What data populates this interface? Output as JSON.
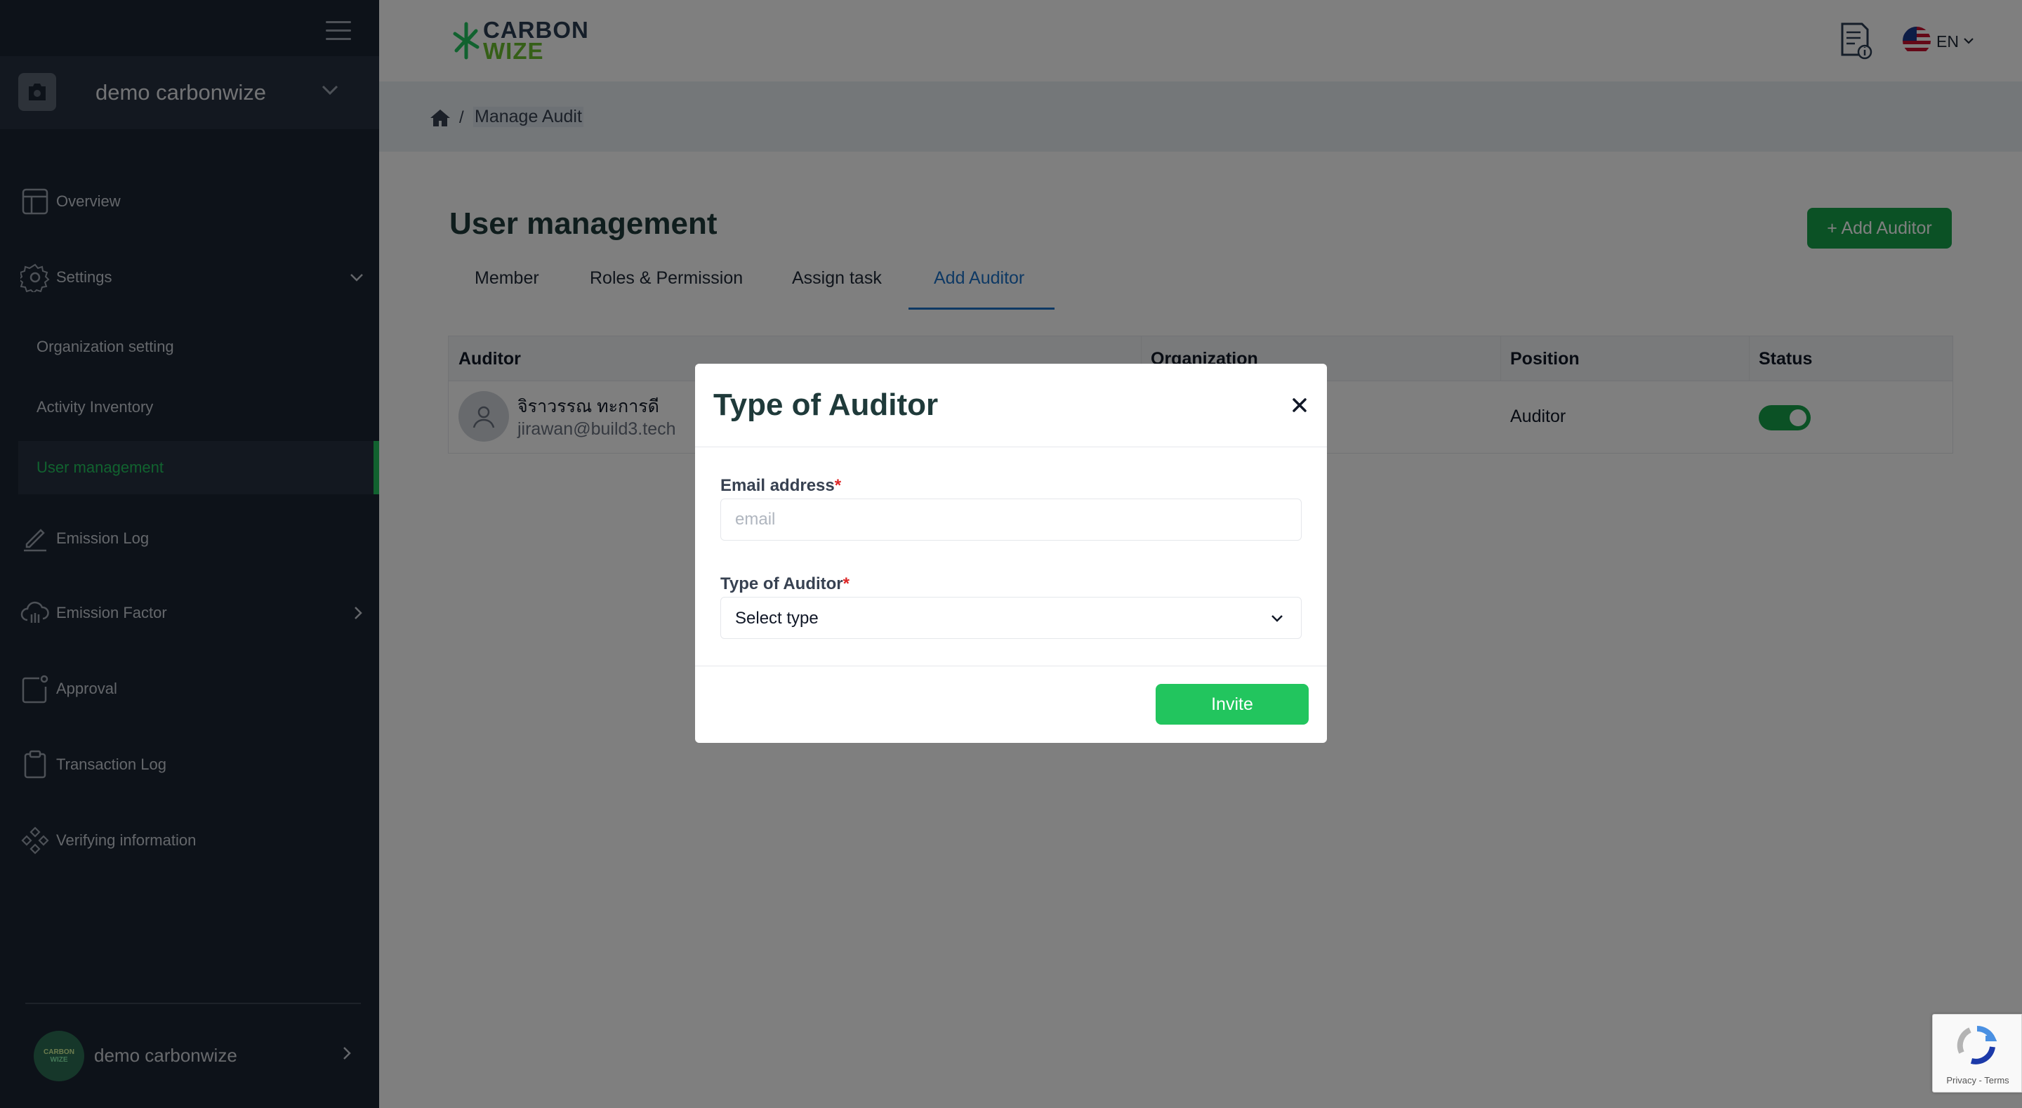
{
  "sidebar": {
    "org_name": "demo carbonwize",
    "nav": {
      "overview": "Overview",
      "settings": "Settings",
      "organization_setting": "Organization setting",
      "activity_inventory": "Activity Inventory",
      "user_management": "User management",
      "emission_log": "Emission Log",
      "emission_factor": "Emission Factor",
      "approval": "Approval",
      "transaction_log": "Transaction Log",
      "verifying_information": "Verifying information"
    },
    "profile": {
      "avatar_line1": "CARBON",
      "avatar_line2": "WIZE",
      "name": "demo carbonwize"
    }
  },
  "header": {
    "logo_line1": "CARBON",
    "logo_line2": "WIZE",
    "language": "EN"
  },
  "breadcrumb": {
    "separator": "/",
    "current": "Manage Audit"
  },
  "page": {
    "title": "User management",
    "add_button": "+ Add Auditor",
    "tabs": [
      "Member",
      "Roles & Permission",
      "Assign task",
      "Add Auditor"
    ],
    "active_tab": "Add Auditor"
  },
  "table": {
    "headers": [
      "Auditor",
      "Organization",
      "Position",
      "Status"
    ],
    "rows": [
      {
        "name": "จิราวรรณ ทะการดี",
        "email": "jirawan@build3.tech",
        "position": "Auditor",
        "status_enabled": true
      }
    ]
  },
  "modal": {
    "title": "Type of Auditor",
    "close_symbol": "×",
    "email_label": "Email address",
    "email_placeholder": "email",
    "email_value": "",
    "type_label": "Type of Auditor",
    "required_mark": "*",
    "type_selected": "Select type",
    "invite_label": "Invite"
  },
  "recaptcha": {
    "text": "Privacy - Terms"
  },
  "colors": {
    "sidebar_bg": "#1b2432",
    "accent_green": "#22c55e",
    "tab_active": "#1d72c9",
    "title": "#1f3a3a"
  }
}
